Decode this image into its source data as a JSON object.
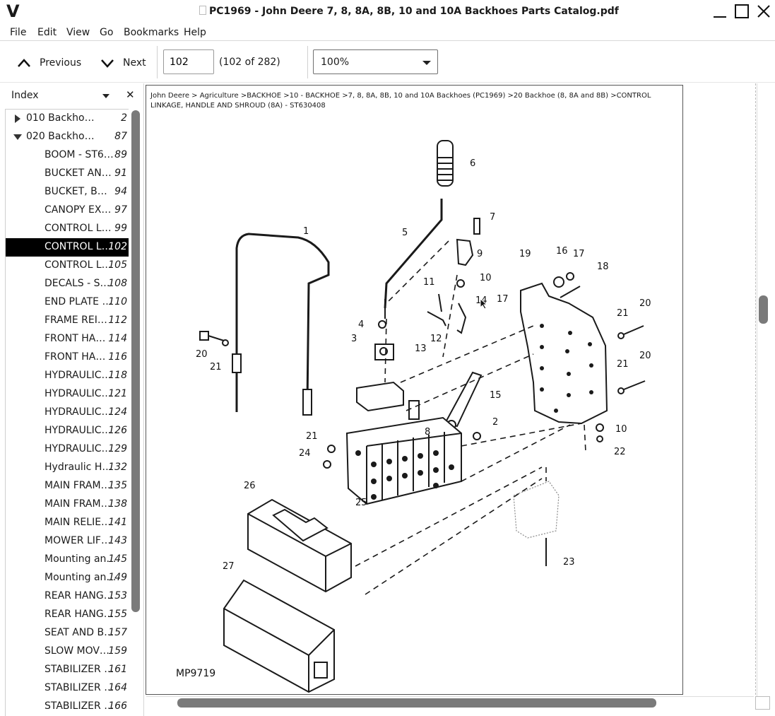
{
  "window": {
    "logo": "V",
    "title": "PC1969 - John Deere 7, 8, 8A, 8B, 10 and 10A Backhoes Parts Catalog.pdf"
  },
  "menu": [
    "File",
    "Edit",
    "View",
    "Go",
    "Bookmarks",
    "Help"
  ],
  "toolbar": {
    "previous_label": "Previous",
    "next_label": "Next",
    "page_value": "102",
    "page_count": "(102 of 282)",
    "zoom_value": "100%"
  },
  "sidebar": {
    "title": "Index",
    "close_glyph": "✕",
    "items": [
      {
        "label": "010 Backho…",
        "page": "2",
        "level": 0,
        "expander": "collapsed"
      },
      {
        "label": "020 Backho…",
        "page": "87",
        "level": 0,
        "expander": "expanded"
      },
      {
        "label": "BOOM - ST6…",
        "page": "89",
        "level": 1
      },
      {
        "label": "BUCKET AN…",
        "page": "91",
        "level": 1
      },
      {
        "label": "BUCKET, B…",
        "page": "94",
        "level": 1
      },
      {
        "label": "CANOPY EX…",
        "page": "97",
        "level": 1
      },
      {
        "label": "CONTROL L…",
        "page": "99",
        "level": 1
      },
      {
        "label": "CONTROL L…",
        "page": "102",
        "level": 1,
        "selected": true
      },
      {
        "label": "CONTROL L…",
        "page": "105",
        "level": 1
      },
      {
        "label": "DECALS - S…",
        "page": "108",
        "level": 1
      },
      {
        "label": "END PLATE …",
        "page": "110",
        "level": 1
      },
      {
        "label": "FRAME REI…",
        "page": "112",
        "level": 1
      },
      {
        "label": "FRONT HA…",
        "page": "114",
        "level": 1
      },
      {
        "label": "FRONT HA…",
        "page": "116",
        "level": 1
      },
      {
        "label": "HYDRAULIC…",
        "page": "118",
        "level": 1
      },
      {
        "label": "HYDRAULIC…",
        "page": "121",
        "level": 1
      },
      {
        "label": "HYDRAULIC…",
        "page": "124",
        "level": 1
      },
      {
        "label": "HYDRAULIC…",
        "page": "126",
        "level": 1
      },
      {
        "label": "HYDRAULIC…",
        "page": "129",
        "level": 1
      },
      {
        "label": "Hydraulic H…",
        "page": "132",
        "level": 1
      },
      {
        "label": "MAIN FRAM…",
        "page": "135",
        "level": 1
      },
      {
        "label": "MAIN FRAM…",
        "page": "138",
        "level": 1
      },
      {
        "label": "MAIN RELIE…",
        "page": "141",
        "level": 1
      },
      {
        "label": "MOWER LIF…",
        "page": "143",
        "level": 1
      },
      {
        "label": "Mounting an…",
        "page": "145",
        "level": 1
      },
      {
        "label": "Mounting an…",
        "page": "149",
        "level": 1
      },
      {
        "label": "REAR HANG…",
        "page": "153",
        "level": 1
      },
      {
        "label": "REAR HANG…",
        "page": "155",
        "level": 1
      },
      {
        "label": "SEAT AND B…",
        "page": "157",
        "level": 1
      },
      {
        "label": "SLOW MOV…",
        "page": "159",
        "level": 1
      },
      {
        "label": "STABILIZER …",
        "page": "161",
        "level": 1
      },
      {
        "label": "STABILIZER …",
        "page": "164",
        "level": 1
      },
      {
        "label": "STABILIZER …",
        "page": "166",
        "level": 1
      }
    ]
  },
  "document": {
    "breadcrumb": "John Deere > Agriculture >BACKHOE >10 - BACKHOE >7, 8, 8A, 8B, 10 and 10A Backhoes (PC1969) >20 Backhoe (8, 8A and 8B) >CONTROL LINKAGE, HANDLE AND SHROUD (8A) - ST630408",
    "figure_code": "MP9719",
    "callouts": [
      "1",
      "2",
      "3",
      "4",
      "5",
      "6",
      "7",
      "8",
      "9",
      "10",
      "10",
      "11",
      "12",
      "13",
      "14",
      "15",
      "16",
      "17",
      "17",
      "18",
      "19",
      "20",
      "20",
      "20",
      "21",
      "21",
      "21",
      "21",
      "22",
      "23",
      "24",
      "25",
      "26",
      "27"
    ]
  },
  "colors": {
    "selected_row_bg": "#000000",
    "scrollbar_thumb": "#7a7a7a",
    "line_art": "#1a1a1a"
  }
}
